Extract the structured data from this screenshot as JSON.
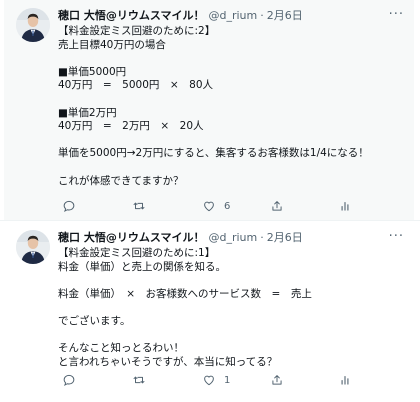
{
  "tweets": [
    {
      "name": "穂口 大悟@リウムスマイル！",
      "handle": "@d_rium",
      "separator": "·",
      "date": "2月6日",
      "more": "···",
      "lines": [
        "【料金設定ミス回避のために:2】",
        "売上目標40万円の場合",
        "",
        "■単価5000円",
        "40万円　=　5000円　×　80人",
        "",
        "■単価2万円",
        "40万円　=　2万円　×　20人",
        "",
        "単価を5000円→2万円にすると、集客するお客様数は1/4になる！",
        "",
        "これが体感できてますか？"
      ],
      "reply_count": "",
      "retweet_count": "",
      "like_count": "6"
    },
    {
      "name": "穂口 大悟@リウムスマイル！",
      "handle": "@d_rium",
      "separator": "·",
      "date": "2月6日",
      "more": "···",
      "lines": [
        "【料金設定ミス回避のために:1】",
        "料金（単価）と売上の関係を知る。",
        "",
        "料金（単価）　×　お客様数へのサービス数　=　売上",
        "",
        "でございます。",
        "",
        "そんなこと知っとるわい！",
        "と言われちゃいそうですが、本当に知ってる？"
      ],
      "reply_count": "",
      "retweet_count": "",
      "like_count": "1"
    }
  ],
  "icons": [
    "avatar",
    "reply-icon",
    "retweet-icon",
    "like-icon",
    "share-icon",
    "analytics-icon",
    "more-icon"
  ],
  "colors": {
    "text": "#0f1419",
    "secondary": "#536471",
    "highlight_bg": "#f7f9f9"
  }
}
